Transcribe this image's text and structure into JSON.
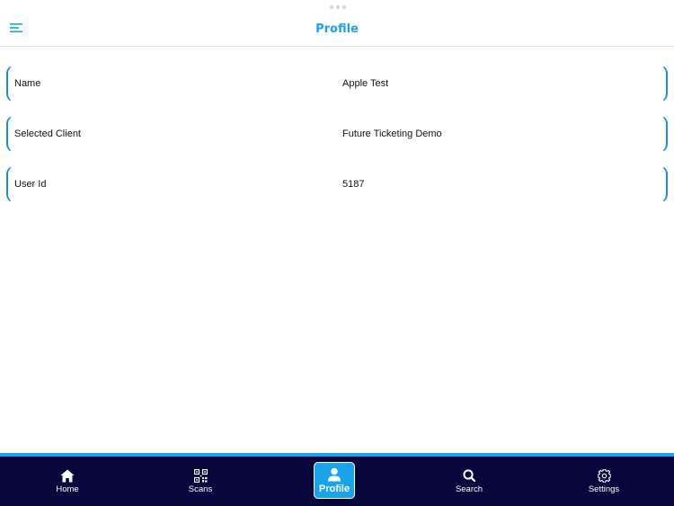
{
  "header": {
    "title": "Profile",
    "menu_icon": "hamburger-menu-icon"
  },
  "profile_rows": [
    {
      "label": "Name",
      "value": "Apple Test"
    },
    {
      "label": "Selected Client",
      "value": "Future Ticketing Demo"
    },
    {
      "label": "User Id",
      "value": "5187"
    }
  ],
  "bottom_nav": {
    "items": [
      {
        "label": "Home",
        "icon": "home-icon",
        "active": false
      },
      {
        "label": "Scans",
        "icon": "qr-code-icon",
        "active": false
      },
      {
        "label": "Profile",
        "icon": "user-icon",
        "active": true
      },
      {
        "label": "Search",
        "icon": "search-icon",
        "active": false
      },
      {
        "label": "Settings",
        "icon": "gear-icon",
        "active": false
      }
    ]
  },
  "colors": {
    "accent": "#1aa3e8",
    "row_border": "#1b8fd6",
    "nav_background": "#07063c"
  }
}
